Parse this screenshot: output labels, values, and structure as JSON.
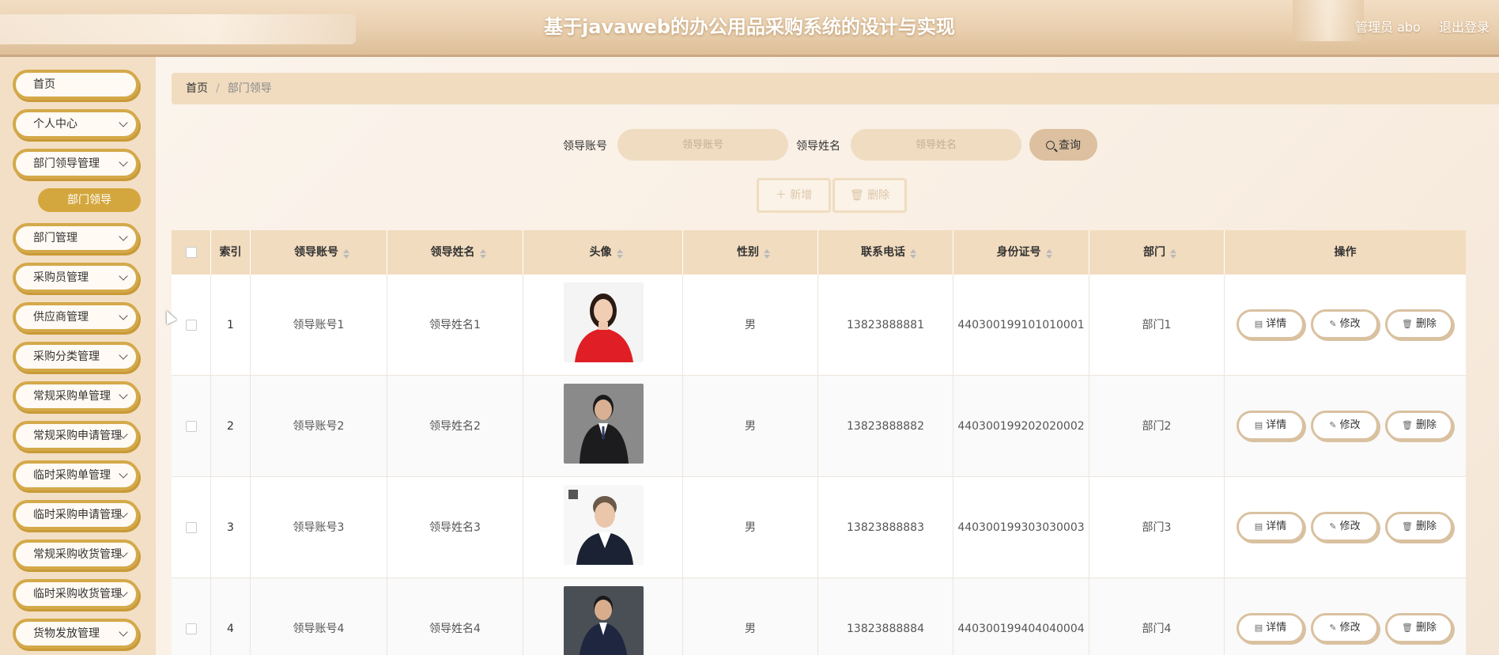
{
  "header": {
    "title": "基于javaweb的办公用品采购系统的设计与实现",
    "user": "管理员 abo",
    "logout": "退出登录"
  },
  "sidebar": {
    "items": [
      {
        "label": "首页",
        "has_children": false
      },
      {
        "label": "个人中心",
        "has_children": true
      },
      {
        "label": "部门领导管理",
        "has_children": true
      },
      {
        "label": "部门管理",
        "has_children": true
      },
      {
        "label": "采购员管理",
        "has_children": true
      },
      {
        "label": "供应商管理",
        "has_children": true
      },
      {
        "label": "采购分类管理",
        "has_children": true
      },
      {
        "label": "常规采购单管理",
        "has_children": true
      },
      {
        "label": "常规采购申请管理",
        "has_children": true
      },
      {
        "label": "临时采购单管理",
        "has_children": true
      },
      {
        "label": "临时采购申请管理",
        "has_children": true
      },
      {
        "label": "常规采购收货管理",
        "has_children": true
      },
      {
        "label": "临时采购收货管理",
        "has_children": true
      },
      {
        "label": "货物发放管理",
        "has_children": true
      }
    ],
    "active_submenu": "部门领导"
  },
  "breadcrumb": {
    "home": "首页",
    "separator": "/",
    "current": "部门领导"
  },
  "search": {
    "account_label": "领导账号",
    "account_placeholder": "领导账号",
    "name_label": "领导姓名",
    "name_placeholder": "领导姓名",
    "query_label": "查询"
  },
  "actions": {
    "add_label": "新增",
    "delete_label": "删除"
  },
  "table": {
    "columns": [
      "索引",
      "领导账号",
      "领导姓名",
      "头像",
      "性别",
      "联系电话",
      "身份证号",
      "部门",
      "操作"
    ],
    "rows": [
      {
        "index": "1",
        "account": "领导账号1",
        "name": "领导姓名1",
        "gender": "男",
        "phone": "13823888881",
        "id_card": "440300199101010001",
        "dept": "部门1"
      },
      {
        "index": "2",
        "account": "领导账号2",
        "name": "领导姓名2",
        "gender": "男",
        "phone": "13823888882",
        "id_card": "440300199202020002",
        "dept": "部门2"
      },
      {
        "index": "3",
        "account": "领导账号3",
        "name": "领导姓名3",
        "gender": "男",
        "phone": "13823888883",
        "id_card": "440300199303030003",
        "dept": "部门3"
      },
      {
        "index": "4",
        "account": "领导账号4",
        "name": "领导姓名4",
        "gender": "男",
        "phone": "13823888884",
        "id_card": "440300199404040004",
        "dept": "部门4"
      }
    ],
    "op_labels": {
      "detail": "详情",
      "edit": "修改",
      "delete": "删除"
    }
  },
  "colors": {
    "accent": "#d4a73e",
    "header_bg": "#e9cfae",
    "table_header_bg": "#f1dcbf"
  }
}
